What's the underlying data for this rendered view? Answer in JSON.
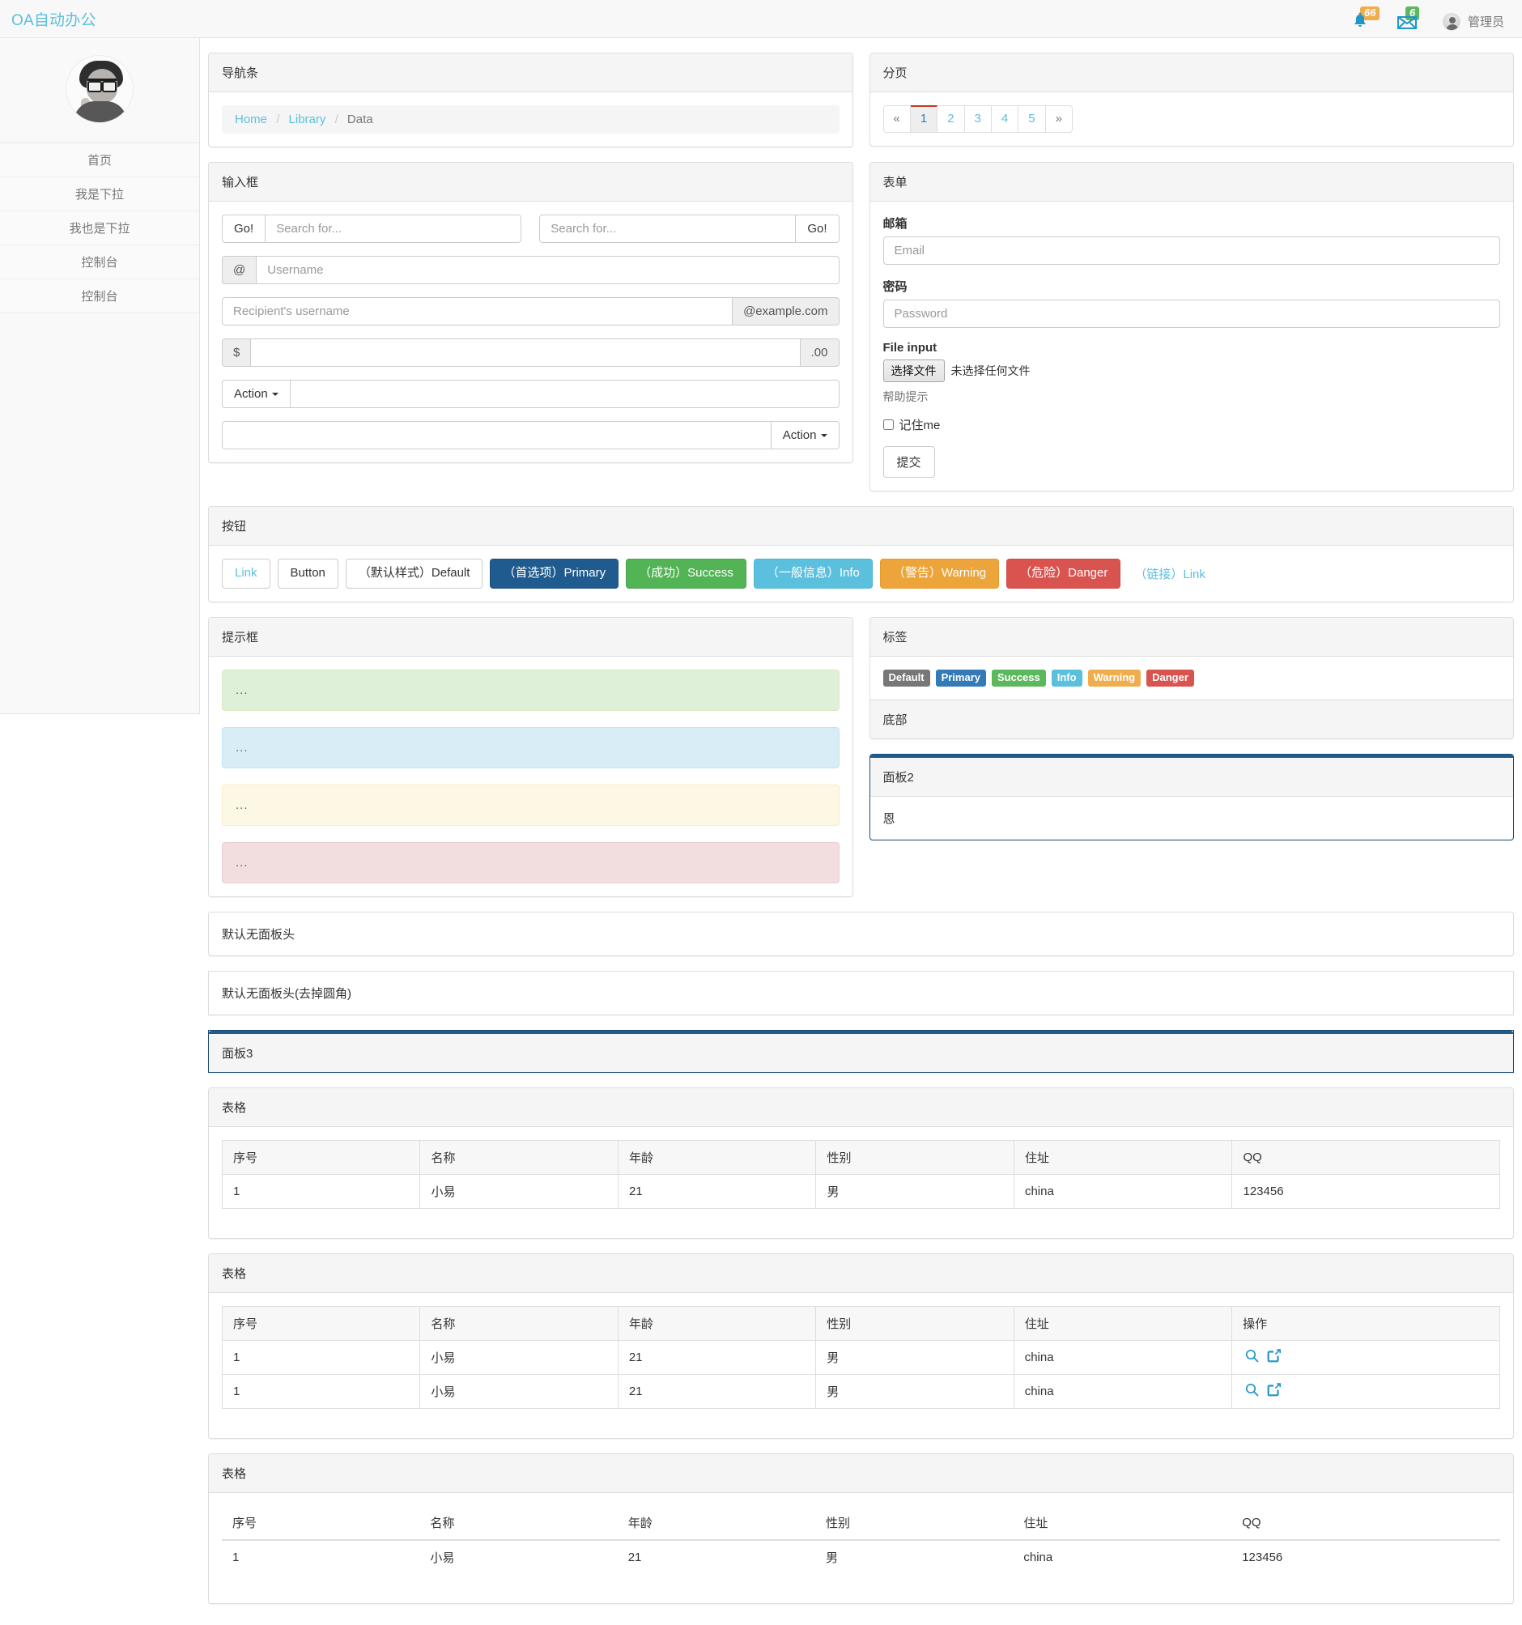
{
  "topbar": {
    "brand": "OA自动办公",
    "notifications_badge": "66",
    "messages_badge": "6",
    "user_name": "管理员"
  },
  "sidebar": {
    "items": [
      {
        "label": "首页"
      },
      {
        "label": "我是下拉"
      },
      {
        "label": "我也是下拉"
      },
      {
        "label": "控制台"
      },
      {
        "label": "控制台"
      }
    ]
  },
  "nav_panel": {
    "title": "导航条",
    "breadcrumb": [
      {
        "label": "Home",
        "link": true
      },
      {
        "label": "Library",
        "link": true
      },
      {
        "label": "Data",
        "link": false
      }
    ],
    "separator": "/"
  },
  "pagination_panel": {
    "title": "分页",
    "prev": "«",
    "next": "»",
    "pages": [
      "1",
      "2",
      "3",
      "4",
      "5"
    ],
    "active_page": "1",
    "active_border_color": "#c0392b"
  },
  "input_panel": {
    "title": "输入框",
    "go_label_left": "Go!",
    "go_label_right": "Go!",
    "search_placeholder_left": "Search for...",
    "search_placeholder_right": "Search for...",
    "at_addon": "@",
    "username_placeholder": "Username",
    "recipient_placeholder": "Recipient's username",
    "domain_addon": "@example.com",
    "dollar_addon": "$",
    "cents_addon": ".00",
    "money_value": "",
    "action_left_label": "Action",
    "action_right_label": "Action",
    "action_left_value": "",
    "action_right_value": ""
  },
  "form_panel": {
    "title": "表单",
    "email_label": "邮箱",
    "email_placeholder": "Email",
    "email_value": "",
    "password_label": "密码",
    "password_placeholder": "Password",
    "password_value": "",
    "file_label": "File input",
    "file_button": "选择文件",
    "file_status": "未选择任何文件",
    "help_text": "帮助提示",
    "remember_label": "记住me",
    "submit_label": "提交"
  },
  "buttons_panel": {
    "title": "按钮",
    "buttons": [
      {
        "label": "Link",
        "style": "btn-link-style"
      },
      {
        "label": "Button",
        "style": "btn-white"
      },
      {
        "label": "（默认样式）Default",
        "style": "btn-white"
      },
      {
        "label": "（首选项）Primary",
        "style": "btn-primary"
      },
      {
        "label": "（成功）Success",
        "style": "btn-success"
      },
      {
        "label": "（一般信息）Info",
        "style": "btn-info"
      },
      {
        "label": "（警告）Warning",
        "style": "btn-warning"
      },
      {
        "label": "（危险）Danger",
        "style": "btn-danger"
      }
    ],
    "trailing_link": "（链接）Link"
  },
  "alerts_panel": {
    "title": "提示框",
    "alerts": [
      {
        "text": "...",
        "style": "alert-success"
      },
      {
        "text": "...",
        "style": "alert-info"
      },
      {
        "text": "...",
        "style": "alert-warning"
      },
      {
        "text": "...",
        "style": "alert-danger"
      }
    ]
  },
  "labels_panel": {
    "title": "标签",
    "footer": "底部",
    "labels": [
      {
        "label": "Default",
        "style": "lbl-default",
        "color": "#777777"
      },
      {
        "label": "Primary",
        "style": "lbl-primary",
        "color": "#337ab7"
      },
      {
        "label": "Success",
        "style": "lbl-success",
        "color": "#5cb85c"
      },
      {
        "label": "Info",
        "style": "lbl-info",
        "color": "#5bc0de"
      },
      {
        "label": "Warning",
        "style": "lbl-warning",
        "color": "#f0ad4e"
      },
      {
        "label": "Danger",
        "style": "lbl-danger",
        "color": "#d9534f"
      }
    ]
  },
  "panel2": {
    "title": "面板2",
    "body": "恩"
  },
  "plain_panels": [
    {
      "body": "默认无面板头"
    },
    {
      "body": "默认无面板头(去掉圆角)"
    }
  ],
  "panel3": {
    "title": "面板3"
  },
  "table1": {
    "title": "表格",
    "columns": [
      "序号",
      "名称",
      "年龄",
      "性别",
      "住址",
      "QQ"
    ],
    "rows": [
      [
        "1",
        "小易",
        "21",
        "男",
        "china",
        "123456"
      ]
    ]
  },
  "table2": {
    "title": "表格",
    "columns": [
      "序号",
      "名称",
      "年龄",
      "性别",
      "住址",
      "操作"
    ],
    "rows": [
      [
        "1",
        "小易",
        "21",
        "男",
        "china"
      ],
      [
        "1",
        "小易",
        "21",
        "男",
        "china"
      ]
    ],
    "action_icons": [
      "search-icon",
      "edit-icon"
    ]
  },
  "table3": {
    "title": "表格",
    "columns": [
      "序号",
      "名称",
      "年龄",
      "性别",
      "住址",
      "QQ"
    ],
    "rows": [
      [
        "1",
        "小易",
        "21",
        "男",
        "china",
        "123456"
      ]
    ]
  }
}
